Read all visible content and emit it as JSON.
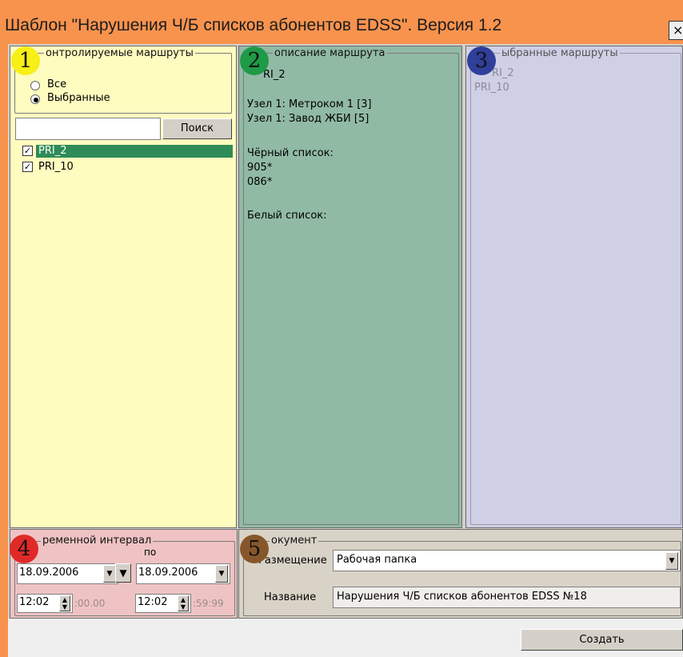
{
  "window": {
    "title": "Шаблон \"Нарушения Ч/Б списков абонентов EDSS\". Версия 1.2",
    "close_label": "×"
  },
  "badges": [
    "1",
    "2",
    "3",
    "4",
    "5"
  ],
  "colors": {
    "badge1": "#f7ef16",
    "badge2": "#1f9a47",
    "badge3": "#2f3f9a",
    "badge4": "#e02a27",
    "badge5": "#86572a",
    "titlebar": "#f8934e"
  },
  "panel1": {
    "legend": "онтролируемые маршруты",
    "radio_all": "Все",
    "radio_selected": "Выбранные",
    "search_value": "",
    "search_button": "Поиск",
    "routes": [
      {
        "label": "PRI_2",
        "checked": true,
        "selected": true
      },
      {
        "label": "PRI_10",
        "checked": true,
        "selected": false
      }
    ]
  },
  "panel2": {
    "legend": "описание маршрута",
    "route_name": "RI_2",
    "nodes": [
      "Узел 1: Метроком 1 [3]",
      "Узел 1: Завод ЖБИ [5]"
    ],
    "black_title": "Чёрный список:",
    "black_entries": [
      "905*",
      "086*"
    ],
    "white_title": "Белый список:"
  },
  "panel3": {
    "legend": "ыбранные маршруты",
    "items": [
      "RI_2",
      "PRI_10"
    ]
  },
  "panel4": {
    "legend": "ременной интервал",
    "to_label": "по",
    "date_from": "18.09.2006",
    "date_to": "18.09.2006",
    "time_from": "12:02",
    "time_from_seconds": ":00.00",
    "time_to": "12:02",
    "time_to_seconds": ":59:99"
  },
  "panel5": {
    "legend": "окумент",
    "location_label": "Размещение",
    "location_value": "Рабочая папка",
    "name_label": "Название",
    "name_value": "Нарушения Ч/Б списков абонентов EDSS №18"
  },
  "bottom": {
    "create_button": "Создать"
  }
}
